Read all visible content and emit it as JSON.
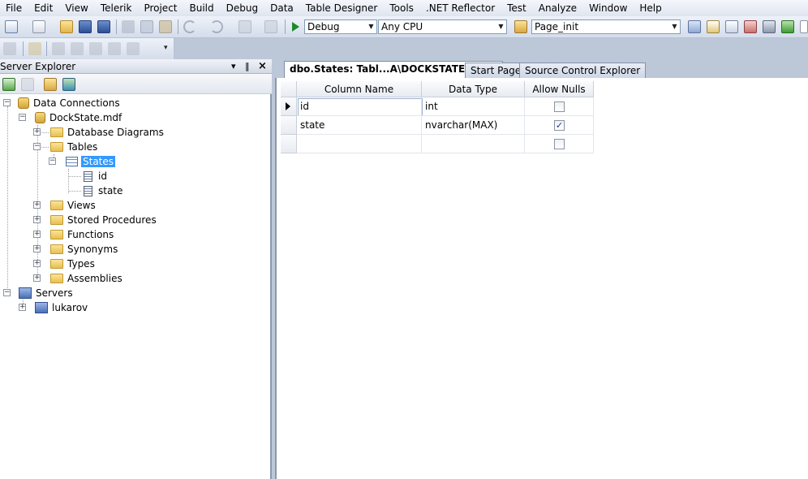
{
  "menu": [
    "File",
    "Edit",
    "View",
    "Telerik",
    "Project",
    "Build",
    "Debug",
    "Data",
    "Table Designer",
    "Tools",
    ".NET Reflector",
    "Test",
    "Analyze",
    "Window",
    "Help"
  ],
  "toolbar": {
    "config_value": "Debug",
    "platform_value": "Any CPU",
    "find_value": "Page_init"
  },
  "server_explorer": {
    "title": "Server Explorer",
    "pin_glyph": "‖",
    "close_glyph": "×",
    "dropdown_glyph": "▾",
    "tree": {
      "data_connections": "Data Connections",
      "database": "DockState.mdf",
      "database_diagrams": "Database Diagrams",
      "tables": "Tables",
      "states_table": "States",
      "columns": [
        "id",
        "state"
      ],
      "views": "Views",
      "stored_procedures": "Stored Procedures",
      "functions": "Functions",
      "synonyms": "Synonyms",
      "types": "Types",
      "assemblies": "Assemblies",
      "servers": "Servers",
      "server_name": "lukarov"
    }
  },
  "tabs": {
    "active": "dbo.States: Tabl...A\\DOCKSTATE.MDF)",
    "start_page": "Start Page",
    "source_control": "Source Control Explorer"
  },
  "table_designer": {
    "headers": [
      "Column Name",
      "Data Type",
      "Allow Nulls"
    ],
    "rows": [
      {
        "name": "id",
        "type": "int",
        "allow_nulls": false,
        "current": true
      },
      {
        "name": "state",
        "type": "nvarchar(MAX)",
        "allow_nulls": true,
        "current": false
      },
      {
        "name": "",
        "type": "",
        "allow_nulls": false,
        "current": false
      }
    ]
  }
}
